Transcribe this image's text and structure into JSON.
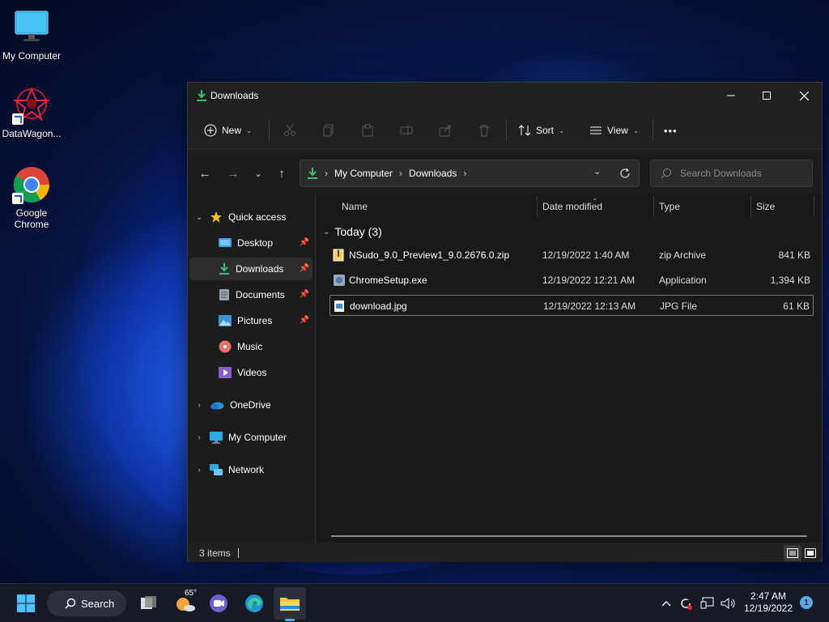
{
  "desktop": {
    "icons": [
      {
        "label": "My Computer",
        "icon": "monitor-icon"
      },
      {
        "label": "DataWagon...",
        "icon": "datawagon-icon"
      },
      {
        "label": "Google Chrome",
        "icon": "chrome-icon"
      }
    ]
  },
  "window": {
    "title": "Downloads",
    "toolbar": {
      "new_label": "New",
      "sort_label": "Sort",
      "view_label": "View",
      "more_label": "•••"
    },
    "address": {
      "segments": [
        "My Computer",
        "Downloads"
      ]
    },
    "search": {
      "placeholder": "Search Downloads"
    },
    "sidebar": {
      "quick_access": "Quick access",
      "items": [
        {
          "label": "Desktop",
          "pinned": true
        },
        {
          "label": "Downloads",
          "pinned": true
        },
        {
          "label": "Documents",
          "pinned": true
        },
        {
          "label": "Pictures",
          "pinned": true
        },
        {
          "label": "Music",
          "pinned": false
        },
        {
          "label": "Videos",
          "pinned": false
        }
      ],
      "onedrive": "OneDrive",
      "my_computer": "My Computer",
      "network": "Network"
    },
    "columns": {
      "name": "Name",
      "date": "Date modified",
      "type": "Type",
      "size": "Size"
    },
    "group": "Today (3)",
    "files": [
      {
        "name": "NSudo_9.0_Preview1_9.0.2676.0.zip",
        "date": "12/19/2022 1:40 AM",
        "type": "zip Archive",
        "size": "841 KB"
      },
      {
        "name": "ChromeSetup.exe",
        "date": "12/19/2022 12:21 AM",
        "type": "Application",
        "size": "1,394 KB"
      },
      {
        "name": "download.jpg",
        "date": "12/19/2022 12:13 AM",
        "type": "JPG File",
        "size": "61 KB"
      }
    ],
    "status": "3 items"
  },
  "taskbar": {
    "search_label": "Search",
    "weather_temp": "65°",
    "time": "2:47 AM",
    "date": "12/19/2022",
    "notifications": "1"
  },
  "colors": {
    "accent": "#0078d4",
    "download_green": "#3fbf6f"
  }
}
